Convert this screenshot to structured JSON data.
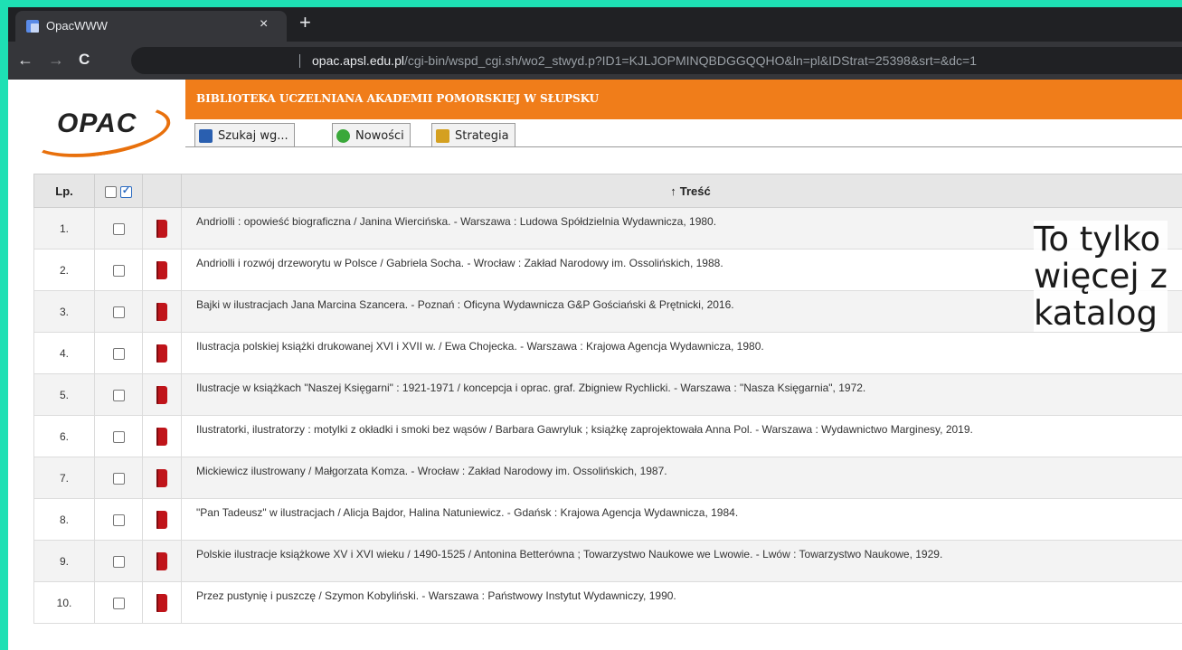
{
  "browser": {
    "tab_title": "OpacWWW",
    "tab_close": "×",
    "new_tab": "+",
    "back": "←",
    "forward": "→",
    "reload": "C",
    "url_host": "opac.apsl.edu.pl",
    "url_path": "/cgi-bin/wspd_cgi.sh/wo2_stwyd.p?ID1=KJLJOPMINQBDGGQQHO&ln=pl&IDStrat=25398&srt=&dc=1"
  },
  "page": {
    "logo": "OPAC",
    "banner_title": "BIBLIOTEKA UCZELNIANA AKADEMII POMORSKIEJ W SŁUPSKU",
    "nav_tabs": [
      {
        "label": "Szukaj wg...",
        "icon": "search-book-icon",
        "color": "#2a5fb0"
      },
      {
        "label": "Nowości",
        "icon": "globe-search-icon",
        "color": "#3aa83a"
      },
      {
        "label": "Strategia",
        "icon": "book-stack-icon",
        "color": "#d4a020"
      }
    ]
  },
  "table": {
    "headers": {
      "lp": "Lp.",
      "tresc": "Treść",
      "sort_arrow": "↑"
    },
    "rows": [
      {
        "lp": "1.",
        "tresc": "Andriolli : opowieść biograficzna / Janina Wiercińska. - Warszawa : Ludowa Spółdzielnia Wydawnicza, 1980."
      },
      {
        "lp": "2.",
        "tresc": "Andriolli i rozwój drzeworytu w Polsce / Gabriela Socha. - Wrocław : Zakład Narodowy im. Ossolińskich, 1988."
      },
      {
        "lp": "3.",
        "tresc": "Bajki w ilustracjach Jana Marcina Szancera. - Poznań : Oficyna Wydawnicza G&P Gościański & Prętnicki, 2016."
      },
      {
        "lp": "4.",
        "tresc": "Ilustracja polskiej książki drukowanej XVI i XVII w. / Ewa Chojecka. - Warszawa : Krajowa Agencja Wydawnicza, 1980."
      },
      {
        "lp": "5.",
        "tresc": "Ilustracje w książkach \"Naszej Księgarni\" : 1921-1971 / koncepcja i oprac. graf. Zbigniew Rychlicki. - Warszawa : \"Nasza Księgarnia\", 1972."
      },
      {
        "lp": "6.",
        "tresc": "Ilustratorki, ilustratorzy : motylki z okładki i smoki bez wąsów / Barbara Gawryluk ; książkę zaprojektowała Anna Pol. - Warszawa : Wydawnictwo Marginesy, 2019."
      },
      {
        "lp": "7.",
        "tresc": "Mickiewicz ilustrowany / Małgorzata Komza. - Wrocław : Zakład Narodowy im. Ossolińskich, 1987."
      },
      {
        "lp": "8.",
        "tresc": "\"Pan Tadeusz\" w ilustracjach / Alicja Bajdor, Halina Natuniewicz. - Gdańsk : Krajowa Agencja Wydawnicza, 1984."
      },
      {
        "lp": "9.",
        "tresc": "Polskie ilustracje książkowe XV i XVI wieku / 1490-1525 / Antonina Betterówna ; Towarzystwo Naukowe we Lwowie. - Lwów : Towarzystwo Naukowe, 1929."
      },
      {
        "lp": "10.",
        "tresc": "Przez pustynię i puszczę / Szymon Kobyliński. - Warszawa : Państwowy Instytut Wydawniczy, 1990."
      }
    ]
  },
  "overlay": {
    "line1": "To tylko",
    "line2": "więcej z",
    "line3": "katalog"
  },
  "colors": {
    "accent": "#f07d1a",
    "border": "#1ee0b4",
    "book": "#c0141a"
  }
}
